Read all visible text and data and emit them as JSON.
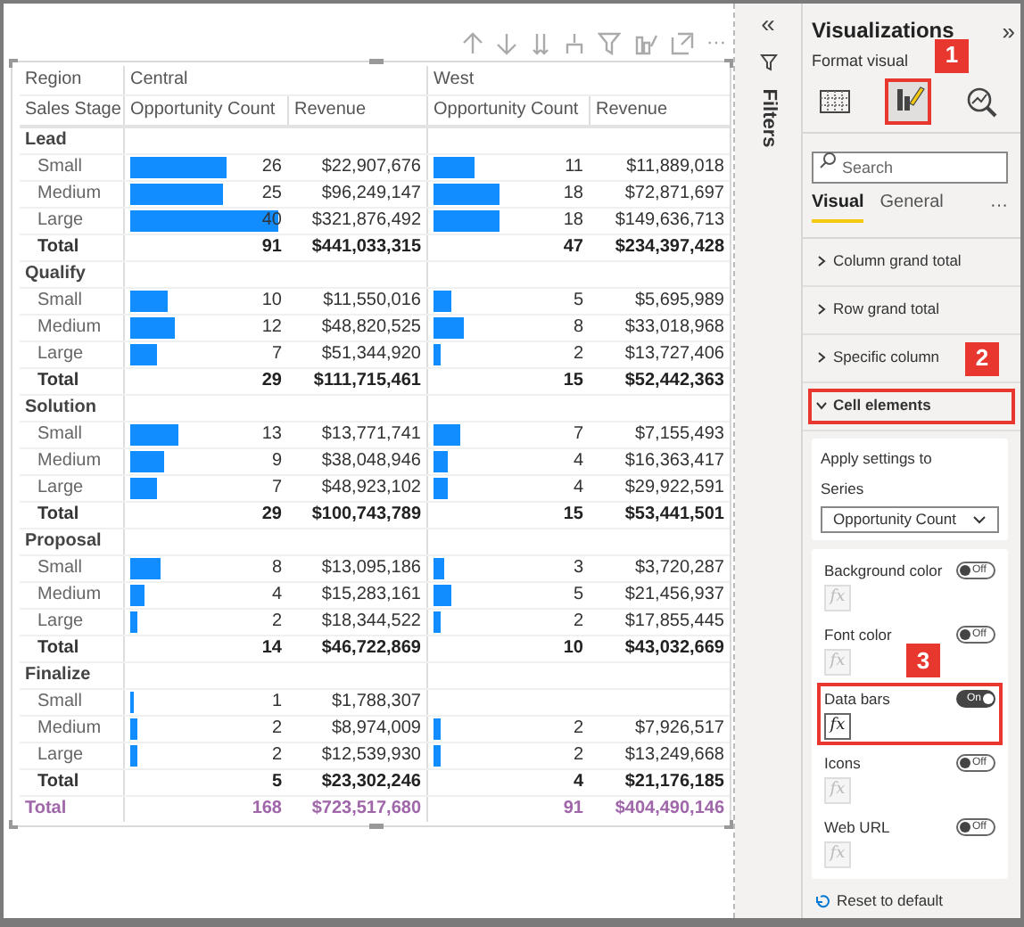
{
  "toolbar": {
    "more": "···"
  },
  "table": {
    "header_1": {
      "label": "Region",
      "regions": [
        "Central",
        "West"
      ]
    },
    "header_2": {
      "label": "Sales Stage",
      "columns": [
        "Opportunity Count",
        "Revenue",
        "Opportunity Count",
        "Revenue"
      ]
    },
    "groups": [
      {
        "name": "Lead",
        "rows": [
          {
            "label": "Small",
            "central": {
              "count": "26",
              "level": 0.65,
              "revenue": "$22,907,676"
            },
            "west": {
              "count": "11",
              "level": 0.275,
              "revenue": "$11,889,018"
            }
          },
          {
            "label": "Medium",
            "central": {
              "count": "25",
              "level": 0.625,
              "revenue": "$96,249,147"
            },
            "west": {
              "count": "18",
              "level": 0.45,
              "revenue": "$72,871,697"
            }
          },
          {
            "label": "Large",
            "central": {
              "count": "40",
              "level": 1,
              "revenue": "$321,876,492"
            },
            "west": {
              "count": "18",
              "level": 0.45,
              "revenue": "$149,636,713"
            }
          }
        ],
        "total": {
          "label": "Total",
          "central": {
            "count": "91",
            "revenue": "$441,033,315"
          },
          "west": {
            "count": "47",
            "revenue": "$234,397,428"
          }
        }
      },
      {
        "name": "Qualify",
        "rows": [
          {
            "label": "Small",
            "central": {
              "count": "10",
              "level": 0.25,
              "revenue": "$11,550,016"
            },
            "west": {
              "count": "5",
              "level": 0.125,
              "revenue": "$5,695,989"
            }
          },
          {
            "label": "Medium",
            "central": {
              "count": "12",
              "level": 0.3,
              "revenue": "$48,820,525"
            },
            "west": {
              "count": "8",
              "level": 0.2,
              "revenue": "$33,018,968"
            }
          },
          {
            "label": "Large",
            "central": {
              "count": "7",
              "level": 0.175,
              "revenue": "$51,344,920"
            },
            "west": {
              "count": "2",
              "level": 0.05,
              "revenue": "$13,727,406"
            }
          }
        ],
        "total": {
          "label": "Total",
          "central": {
            "count": "29",
            "revenue": "$111,715,461"
          },
          "west": {
            "count": "15",
            "revenue": "$52,442,363"
          }
        }
      },
      {
        "name": "Solution",
        "rows": [
          {
            "label": "Small",
            "central": {
              "count": "13",
              "level": 0.325,
              "revenue": "$13,771,741"
            },
            "west": {
              "count": "7",
              "level": 0.175,
              "revenue": "$7,155,493"
            }
          },
          {
            "label": "Medium",
            "central": {
              "count": "9",
              "level": 0.225,
              "revenue": "$38,048,946"
            },
            "west": {
              "count": "4",
              "level": 0.1,
              "revenue": "$16,363,417"
            }
          },
          {
            "label": "Large",
            "central": {
              "count": "7",
              "level": 0.175,
              "revenue": "$48,923,102"
            },
            "west": {
              "count": "4",
              "level": 0.1,
              "revenue": "$29,922,591"
            }
          }
        ],
        "total": {
          "label": "Total",
          "central": {
            "count": "29",
            "revenue": "$100,743,789"
          },
          "west": {
            "count": "15",
            "revenue": "$53,441,501"
          }
        }
      },
      {
        "name": "Proposal",
        "rows": [
          {
            "label": "Small",
            "central": {
              "count": "8",
              "level": 0.2,
              "revenue": "$13,095,186"
            },
            "west": {
              "count": "3",
              "level": 0.075,
              "revenue": "$3,720,287"
            }
          },
          {
            "label": "Medium",
            "central": {
              "count": "4",
              "level": 0.1,
              "revenue": "$15,283,161"
            },
            "west": {
              "count": "5",
              "level": 0.125,
              "revenue": "$21,456,937"
            }
          },
          {
            "label": "Large",
            "central": {
              "count": "2",
              "level": 0.05,
              "revenue": "$18,344,522"
            },
            "west": {
              "count": "2",
              "level": 0.05,
              "revenue": "$17,855,445"
            }
          }
        ],
        "total": {
          "label": "Total",
          "central": {
            "count": "14",
            "revenue": "$46,722,869"
          },
          "west": {
            "count": "10",
            "revenue": "$43,032,669"
          }
        }
      },
      {
        "name": "Finalize",
        "rows": [
          {
            "label": "Small",
            "central": {
              "count": "1",
              "level": 0.025,
              "revenue": "$1,788,307"
            }
          },
          {
            "label": "Medium",
            "central": {
              "count": "2",
              "level": 0.05,
              "revenue": "$8,974,009"
            },
            "west": {
              "count": "2",
              "level": 0.05,
              "revenue": "$7,926,517"
            }
          },
          {
            "label": "Large",
            "central": {
              "count": "2",
              "level": 0.05,
              "revenue": "$12,539,930"
            },
            "west": {
              "count": "2",
              "level": 0.05,
              "revenue": "$13,249,668"
            }
          }
        ],
        "total": {
          "label": "Total",
          "central": {
            "count": "5",
            "revenue": "$23,302,246"
          },
          "west": {
            "count": "4",
            "revenue": "$21,176,185"
          }
        }
      }
    ],
    "grand_total": {
      "label": "Total",
      "central": {
        "count": "168",
        "revenue": "$723,517,680"
      },
      "west": {
        "count": "91",
        "revenue": "$404,490,146"
      }
    }
  },
  "filters_pane": {
    "collapse": "«",
    "title": "Filters"
  },
  "visualizations_pane": {
    "title": "Visualizations",
    "expand": "»",
    "subtitle": "Format visual",
    "view_buttons": [
      {
        "kind": "build",
        "selected": false
      },
      {
        "kind": "format",
        "selected": true,
        "callout": "1"
      },
      {
        "kind": "analytics",
        "selected": false
      }
    ],
    "search": {
      "placeholder": "Search"
    },
    "tabs": [
      {
        "label": "Visual",
        "selected": true
      },
      {
        "label": "General",
        "selected": false
      }
    ],
    "more": "···",
    "sections": [
      {
        "label": "Column grand total",
        "expanded": false
      },
      {
        "label": "Row grand total",
        "expanded": false
      },
      {
        "label": "Specific column",
        "expanded": false,
        "callout": "2"
      },
      {
        "label": "Cell elements",
        "expanded": true,
        "highlighted": true
      }
    ],
    "apply_card": {
      "title": "Apply settings to",
      "series_label": "Series",
      "series_value": "Opportunity Count"
    },
    "settings": [
      {
        "label": "Background color",
        "on": false,
        "toggle_text": "Off",
        "fx": "fx"
      },
      {
        "label": "Font color",
        "on": false,
        "toggle_text": "Off",
        "fx": "fx",
        "callout": "3"
      },
      {
        "label": "Data bars",
        "on": true,
        "toggle_text": "On",
        "fx": "fx",
        "highlighted": true
      },
      {
        "label": "Icons",
        "on": false,
        "toggle_text": "Off",
        "fx": "fx"
      },
      {
        "label": "Web URL",
        "on": false,
        "toggle_text": "Off",
        "fx": "fx"
      }
    ],
    "reset": "Reset to default"
  }
}
